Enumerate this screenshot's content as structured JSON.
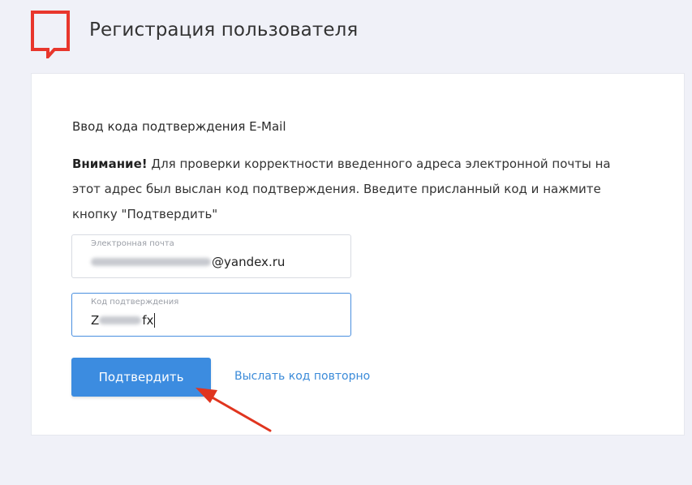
{
  "header": {
    "title": "Регистрация пользователя",
    "logo_icon": "speech-bubble-logo-icon",
    "logo_color": "#e8362c"
  },
  "form": {
    "subtitle": "Ввод кода подтверждения E-Mail",
    "notice_bold": "Внимание!",
    "notice_text": " Для проверки корректности введенного адреса электронной почты на этот адрес был выслан код подтверждения. Введите присланный код и нажмите кнопку \"Подтвердить\"",
    "email": {
      "label": "Электронная почта",
      "value_visible": "@yandex.ru"
    },
    "code": {
      "label": "Код подтверждения",
      "value_prefix": "Z",
      "value_suffix": "fx"
    },
    "confirm_button": "Подтвердить",
    "resend_link": "Выслать код повторно"
  },
  "colors": {
    "accent": "#3c8ce0",
    "link": "#3b8bd9",
    "annotation_arrow": "#e0351f"
  },
  "annotation": {
    "arrow_icon": "red-pointer-arrow-icon"
  }
}
